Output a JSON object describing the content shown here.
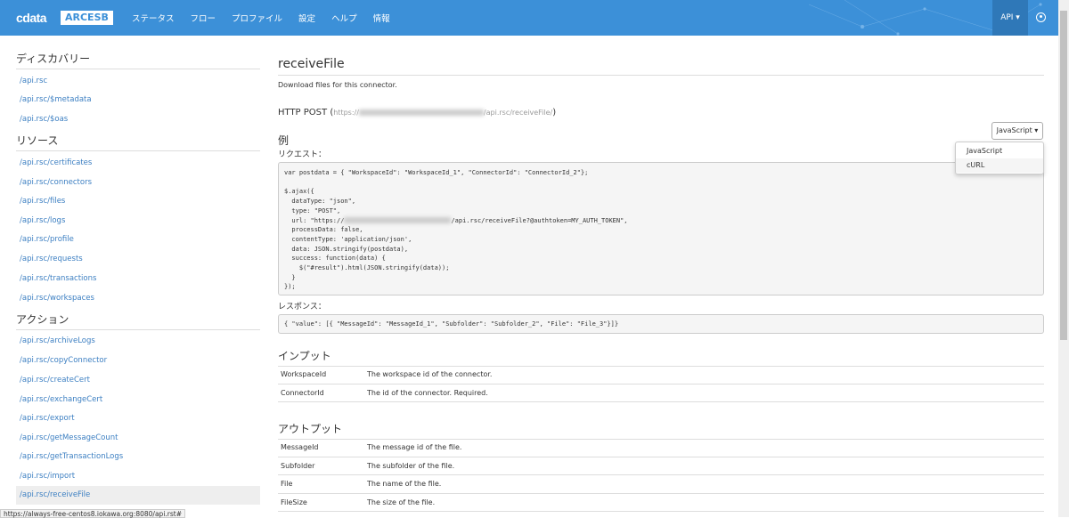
{
  "nav": {
    "logo": "cdata",
    "product": "ARCESB",
    "menu": [
      "ステータス",
      "フロー",
      "プロファイル",
      "設定",
      "ヘルプ",
      "情報"
    ],
    "api": "API ▾"
  },
  "sidebar": {
    "sections": [
      {
        "title": "ディスカバリー",
        "items": [
          "/api.rsc",
          "/api.rsc/$metadata",
          "/api.rsc/$oas"
        ]
      },
      {
        "title": "リソース",
        "items": [
          "/api.rsc/certificates",
          "/api.rsc/connectors",
          "/api.rsc/files",
          "/api.rsc/logs",
          "/api.rsc/profile",
          "/api.rsc/requests",
          "/api.rsc/transactions",
          "/api.rsc/workspaces"
        ]
      },
      {
        "title": "アクション",
        "items": [
          "/api.rsc/archiveLogs",
          "/api.rsc/copyConnector",
          "/api.rsc/createCert",
          "/api.rsc/exchangeCert",
          "/api.rsc/export",
          "/api.rsc/getMessageCount",
          "/api.rsc/getTransactionLogs",
          "/api.rsc/import",
          "/api.rsc/receiveFile"
        ]
      }
    ]
  },
  "main": {
    "title": "receiveFile",
    "description": "Download files for this connector.",
    "http_method": "HTTP POST",
    "url_prefix": "https://",
    "url_suffix": "/api.rsc/receiveFile/",
    "example_heading": "例",
    "request_label": "リクエスト：",
    "response_label": "レスポンス：",
    "lang_button": "JavaScript ▾",
    "lang_options": [
      "JavaScript",
      "cURL"
    ],
    "code_line1": "var postdata = { \"WorkspaceId\": \"WorkspaceId_1\", \"ConnectorId\": \"ConnectorId_2\"};",
    "code_a": "\n$.ajax({\n  dataType: \"json\",\n  type: \"POST\",\n  url: \"https://",
    "code_b": "/api.rsc/receiveFile?@authtoken=MY_AUTH_TOKEN\",\n  processData: false,\n  contentType: 'application/json',\n  data: JSON.stringify(postdata),\n  success: function(data) {\n    $(\"#result\").html(JSON.stringify(data));\n  }\n});",
    "response": "{ \"value\": [{ \"MessageId\": \"MessageId_1\", \"Subfolder\": \"Subfolder_2\", \"File\": \"File_3\"}]}",
    "input_heading": "インプット",
    "inputs": [
      [
        "WorkspaceId",
        "The workspace id of the connector."
      ],
      [
        "ConnectorId",
        "The id of the connector. Required."
      ]
    ],
    "output_heading": "アウトプット",
    "outputs": [
      [
        "MessageId",
        "The message id of the file."
      ],
      [
        "Subfolder",
        "The subfolder of the file."
      ],
      [
        "File",
        "The name of the file."
      ],
      [
        "FileSize",
        "The size of the file."
      ]
    ]
  },
  "status_url": "https://always-free-centos8.iokawa.org:8080/api.rst#"
}
